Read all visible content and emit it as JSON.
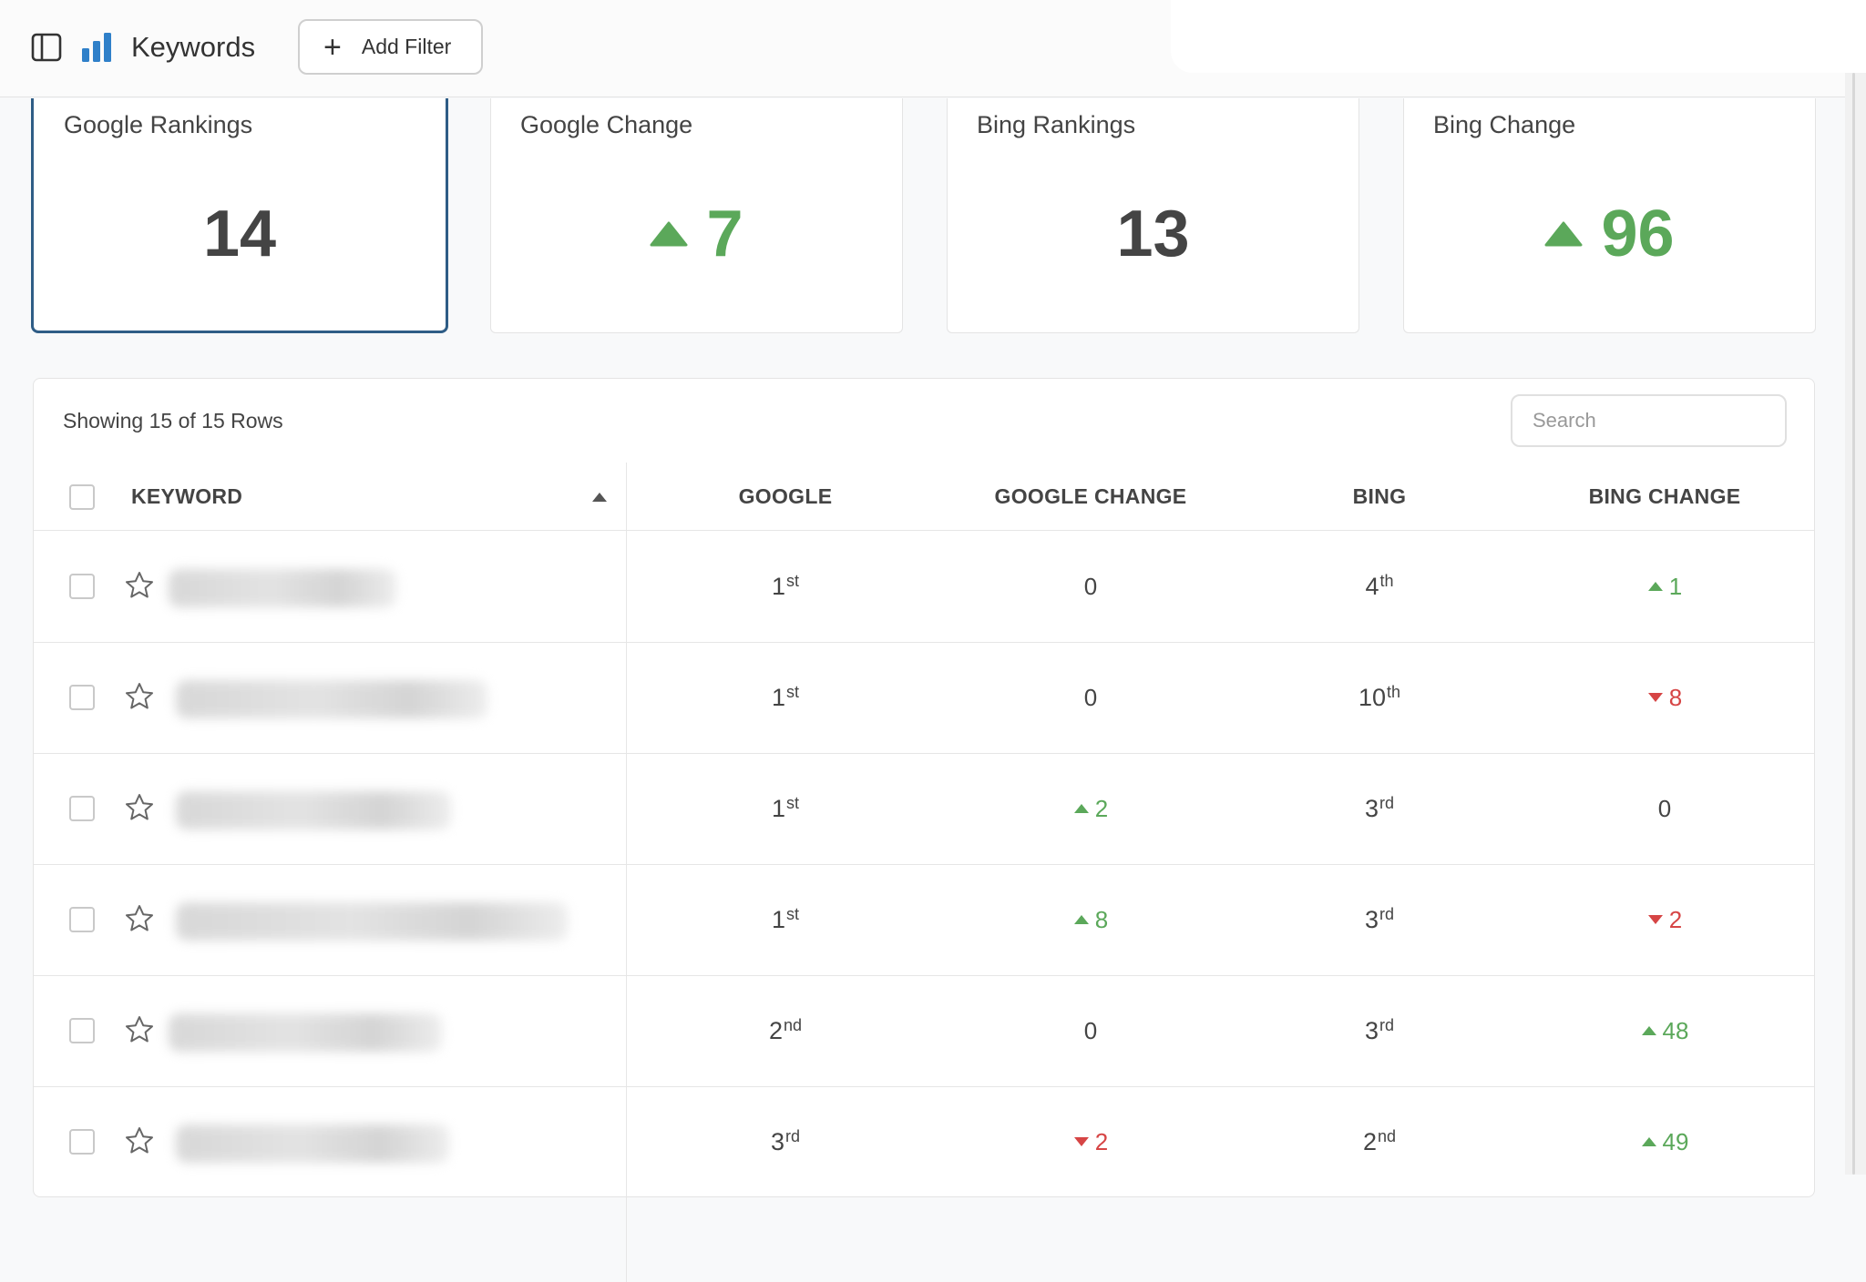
{
  "app": {
    "title": "Keywords"
  },
  "toolbar": {
    "add_filter_label": "Add Filter"
  },
  "colors": {
    "accent": "#2f5d86",
    "up": "#5ba85a",
    "down": "#d64545",
    "brand": "#2f80c9"
  },
  "icons": {
    "sidebar_toggle": "sidebar-toggle-icon",
    "brand": "bar-chart-icon",
    "add": "plus-icon",
    "favorite": "star-outline-icon",
    "trend_up": "triangle-up-icon",
    "trend_down": "triangle-down-icon",
    "sort": "sort-ascending-icon"
  },
  "cards": [
    {
      "title": "Google Rankings",
      "value": "14",
      "trend": "none",
      "selected": true
    },
    {
      "title": "Google Change",
      "value": "7",
      "trend": "up",
      "selected": false
    },
    {
      "title": "Bing Rankings",
      "value": "13",
      "trend": "none",
      "selected": false
    },
    {
      "title": "Bing Change",
      "value": "96",
      "trend": "up",
      "selected": false
    }
  ],
  "table": {
    "rows_info": "Showing 15 of 15 Rows",
    "search_placeholder": "Search",
    "columns": {
      "keyword": "KEYWORD",
      "google": "GOOGLE",
      "google_change": "GOOGLE CHANGE",
      "bing": "BING",
      "bing_change": "BING CHANGE"
    },
    "rows": [
      {
        "google": "1",
        "google_suffix": "st",
        "google_change": "0",
        "google_change_dir": "none",
        "bing": "4",
        "bing_suffix": "th",
        "bing_change": "1",
        "bing_change_dir": "up"
      },
      {
        "google": "1",
        "google_suffix": "st",
        "google_change": "0",
        "google_change_dir": "none",
        "bing": "10",
        "bing_suffix": "th",
        "bing_change": "8",
        "bing_change_dir": "down"
      },
      {
        "google": "1",
        "google_suffix": "st",
        "google_change": "2",
        "google_change_dir": "up",
        "bing": "3",
        "bing_suffix": "rd",
        "bing_change": "0",
        "bing_change_dir": "none"
      },
      {
        "google": "1",
        "google_suffix": "st",
        "google_change": "8",
        "google_change_dir": "up",
        "bing": "3",
        "bing_suffix": "rd",
        "bing_change": "2",
        "bing_change_dir": "down"
      },
      {
        "google": "2",
        "google_suffix": "nd",
        "google_change": "0",
        "google_change_dir": "none",
        "bing": "3",
        "bing_suffix": "rd",
        "bing_change": "48",
        "bing_change_dir": "up"
      },
      {
        "google": "3",
        "google_suffix": "rd",
        "google_change": "2",
        "google_change_dir": "down",
        "bing": "2",
        "bing_suffix": "nd",
        "bing_change": "49",
        "bing_change_dir": "up"
      }
    ]
  }
}
